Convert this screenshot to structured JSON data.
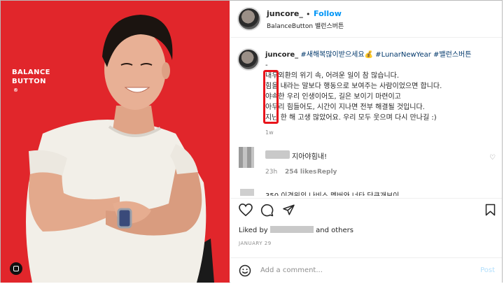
{
  "post": {
    "username": "juncore_",
    "dot": "•",
    "follow_label": "Follow",
    "subtitle": "BalanceButton 밸런스버튼",
    "brand_line1": "BALANCE",
    "brand_line2": "BUTTON",
    "brand_reg": "®"
  },
  "caption": {
    "username": "juncore_",
    "hashtags_line": "#새해복많이받으세요💰 #LunarNewYear #밸런스버튼",
    "line0": "-",
    "line1": "내우외환의 위기 속, 어려운 일이 참 많습니다.",
    "line2": "힘을 내라는 말보다 행동으로 보여주는 사람이었으면 합니다.",
    "line3": "야속한 우리 인생이어도, 길은 보이기 마련이고",
    "line4": "아무리 힘들어도, 시간이 지나면 전부 해결될 것입니다.",
    "line5": "지난 한 해 고생 많았어요. 우리 모두 웃으며 다시 만나길 :)",
    "time": "1w"
  },
  "comment": {
    "text": "지아야힘내!",
    "time": "23h",
    "likes": "254 likes",
    "reply": "Reply",
    "next_partial": "350 이경위의 나비스 멤버와 너타 당큰개보이"
  },
  "likes": {
    "prefix": "Liked by",
    "suffix": "and others"
  },
  "date": "JANUARY 29",
  "add_comment": {
    "placeholder": "Add a comment...",
    "post_label": "Post"
  },
  "colors": {
    "photo_bg": "#e1262b",
    "link": "#0095f6",
    "hashtag": "#00376b",
    "highlight_box": "#e8141b"
  }
}
